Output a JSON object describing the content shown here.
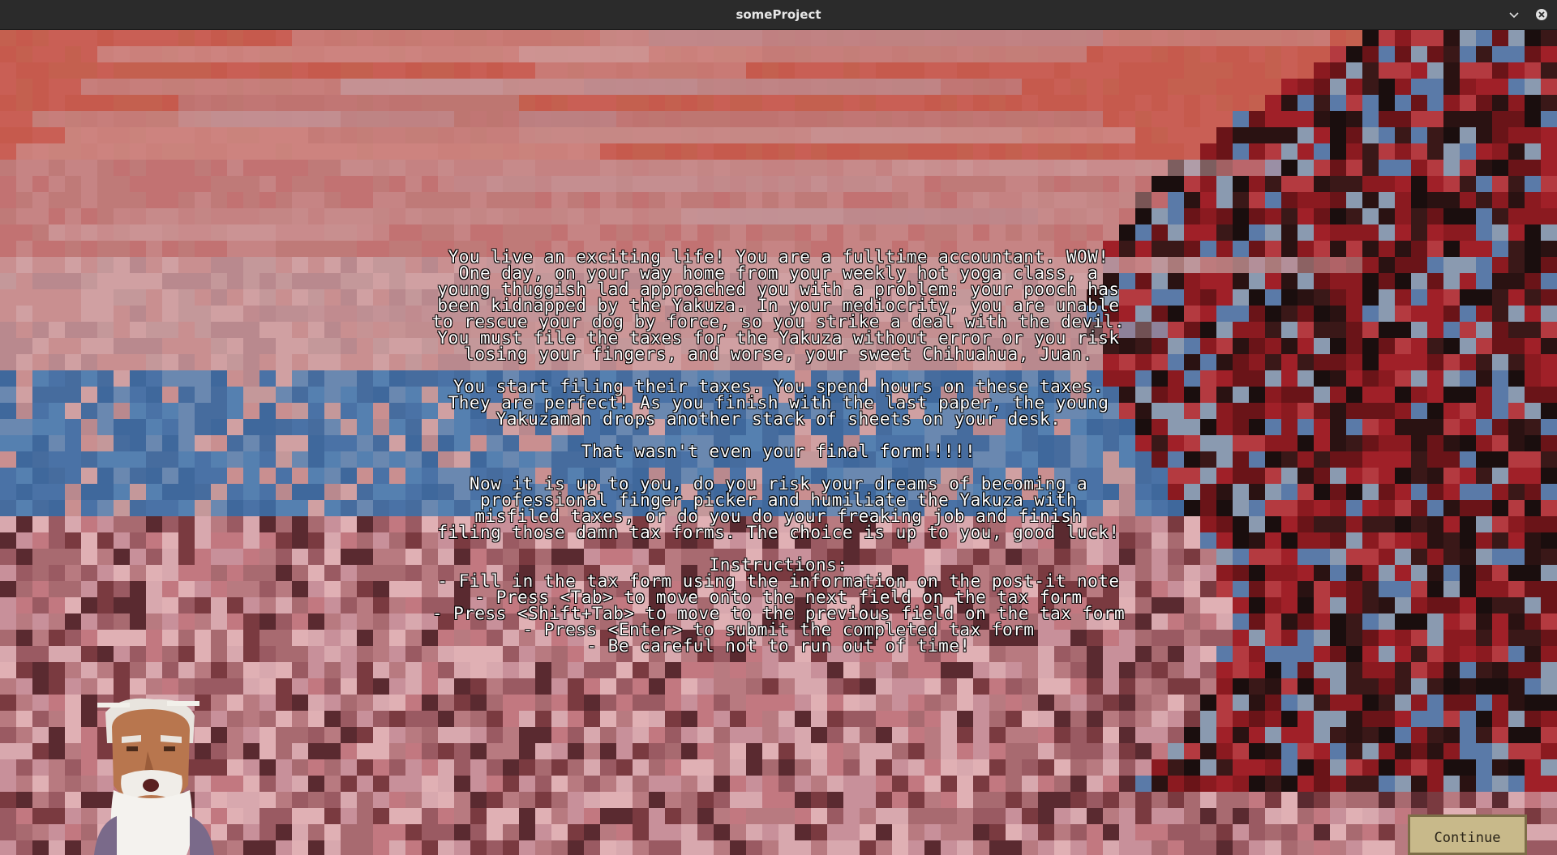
{
  "window": {
    "title": "someProject"
  },
  "story": {
    "paragraphs": [
      "You live an exciting life! You are a fulltime accountant. WOW!\nOne day, on your way home from your weekly hot yoga class, a\nyoung thuggish lad approached you with a problem: your pooch has\nbeen kidnapped by the Yakuza. In your mediocrity, you are unable\nto rescue your dog by force, so you strike a deal with the devil.\nYou must file the taxes for the Yakuza without error or you risk\nlosing your fingers, and worse, your sweet Chihuahua, Juan.",
      "You start filing their taxes. You spend hours on these taxes.\nThey are perfect! As you finish with the last paper, the young\nYakuzaman drops another stack of sheets on your desk.",
      "That wasn't even your final form!!!!!",
      "Now it is up to you, do you risk your dreams of becoming a\nprofessional finger picker and humiliate the Yakuza with\nmisfiled taxes, or do you do your freaking job and finish\nfiling those damn tax forms. The choice is up to you, good luck!"
    ],
    "instructions": "Instructions:\n- Fill in the tax form using the information on the post-it note\n- Press <Tab> to move onto the next field on the tax form\n- Press <Shift+Tab> to move to the previous field on the tax form\n- Press <Enter> to submit the completed tax form\n- Be careful not to run out of time!"
  },
  "continue_label": "Continue",
  "icons": {
    "minimize": "chevron-down-icon",
    "close": "close-icon",
    "character": "old-sage-portrait-icon"
  },
  "colors": {
    "titlebar": "#2b2b2b",
    "sky_top": "#c65a4d",
    "sky_mid": "#c98f90",
    "lake": "#4a72a6",
    "ground": "#b87a80",
    "tree_red": "#8b1a20",
    "tree_dark": "#2a1212",
    "button_bg": "#c8b98a"
  }
}
